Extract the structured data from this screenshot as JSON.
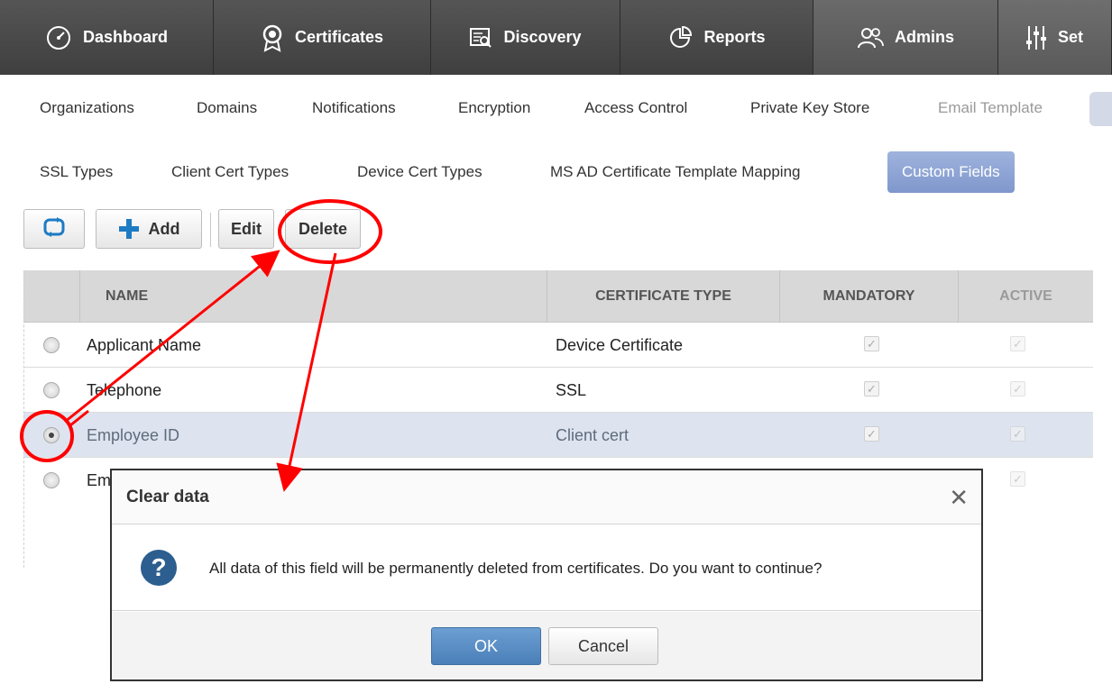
{
  "topnav": {
    "tabs": [
      {
        "label": "Dashboard",
        "icon": "dashboard-icon"
      },
      {
        "label": "Certificates",
        "icon": "certificate-icon"
      },
      {
        "label": "Discovery",
        "icon": "discovery-icon"
      },
      {
        "label": "Reports",
        "icon": "reports-icon"
      },
      {
        "label": "Admins",
        "icon": "admins-icon"
      },
      {
        "label": "Set",
        "icon": "settings-icon"
      }
    ]
  },
  "subnav": {
    "items": [
      "Organizations",
      "Domains",
      "Notifications",
      "Encryption",
      "Access Control",
      "Private Key Store",
      "Email Template"
    ]
  },
  "subnav2": {
    "items": [
      "SSL Types",
      "Client Cert Types",
      "Device Cert Types",
      "MS AD Certificate Template Mapping",
      "Custom Fields"
    ],
    "selected": "Custom Fields"
  },
  "toolbar": {
    "add_label": "Add",
    "edit_label": "Edit",
    "delete_label": "Delete"
  },
  "grid": {
    "columns": [
      "NAME",
      "CERTIFICATE TYPE",
      "MANDATORY",
      "ACTIVE"
    ],
    "rows": [
      {
        "name": "Applicant Name",
        "type": "Device Certificate",
        "mandatory": true,
        "active": true,
        "selected": false
      },
      {
        "name": "Telephone",
        "type": "SSL",
        "mandatory": true,
        "active": true,
        "selected": false
      },
      {
        "name": "Employee ID",
        "type": "Client cert",
        "mandatory": true,
        "active": true,
        "selected": true
      },
      {
        "name": "Em",
        "type": "",
        "mandatory": false,
        "active": true,
        "selected": false
      }
    ]
  },
  "dialog": {
    "title": "Clear data",
    "message": "All data of this field will be permanently deleted from certificates. Do you want to continue?",
    "ok_label": "OK",
    "cancel_label": "Cancel",
    "close_glyph": "✕"
  },
  "colors": {
    "nav_bg": "#4a4a4a",
    "selected_tab": "#8ba2d3",
    "annotation": "#ff0000",
    "ok_button": "#5a8cc4"
  }
}
